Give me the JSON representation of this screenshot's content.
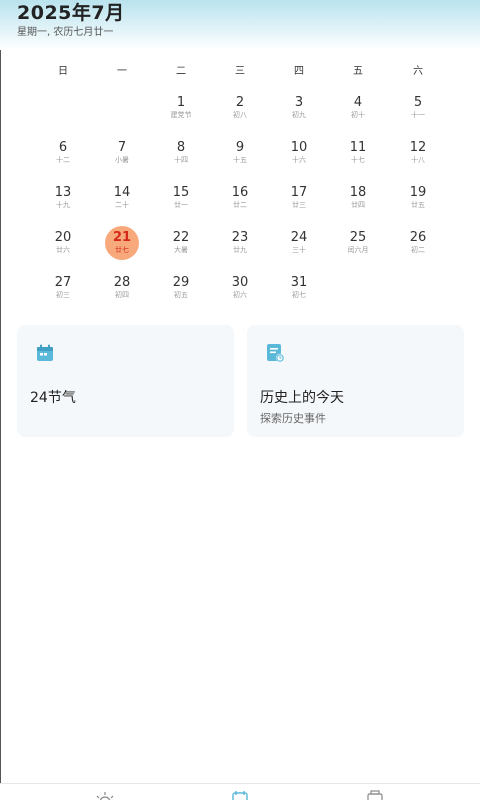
{
  "header": {
    "title": "2025年7月",
    "subtitle": "星期一, 农历七月廿一"
  },
  "weekdays": [
    "日",
    "一",
    "二",
    "三",
    "四",
    "五",
    "六"
  ],
  "calendar": {
    "first_weekday_index": 2,
    "today": 21,
    "days": [
      {
        "num": "1",
        "lunar": "建党节"
      },
      {
        "num": "2",
        "lunar": "初八"
      },
      {
        "num": "3",
        "lunar": "初九"
      },
      {
        "num": "4",
        "lunar": "初十"
      },
      {
        "num": "5",
        "lunar": "十一"
      },
      {
        "num": "6",
        "lunar": "十二"
      },
      {
        "num": "7",
        "lunar": "小暑"
      },
      {
        "num": "8",
        "lunar": "十四"
      },
      {
        "num": "9",
        "lunar": "十五"
      },
      {
        "num": "10",
        "lunar": "十六"
      },
      {
        "num": "11",
        "lunar": "十七"
      },
      {
        "num": "12",
        "lunar": "十八"
      },
      {
        "num": "13",
        "lunar": "十九"
      },
      {
        "num": "14",
        "lunar": "二十"
      },
      {
        "num": "15",
        "lunar": "廿一"
      },
      {
        "num": "16",
        "lunar": "廿二"
      },
      {
        "num": "17",
        "lunar": "廿三"
      },
      {
        "num": "18",
        "lunar": "廿四"
      },
      {
        "num": "19",
        "lunar": "廿五"
      },
      {
        "num": "20",
        "lunar": "廿六"
      },
      {
        "num": "21",
        "lunar": "廿七"
      },
      {
        "num": "22",
        "lunar": "大暑"
      },
      {
        "num": "23",
        "lunar": "廿九"
      },
      {
        "num": "24",
        "lunar": "三十"
      },
      {
        "num": "25",
        "lunar": "闰六月"
      },
      {
        "num": "26",
        "lunar": "初二"
      },
      {
        "num": "27",
        "lunar": "初三"
      },
      {
        "num": "28",
        "lunar": "初四"
      },
      {
        "num": "29",
        "lunar": "初五"
      },
      {
        "num": "30",
        "lunar": "初六"
      },
      {
        "num": "31",
        "lunar": "初七"
      }
    ]
  },
  "cards": {
    "solar_terms": {
      "title": "24节气",
      "icon": "calendar-icon"
    },
    "history": {
      "title": "历史上的今天",
      "subtitle": "探索历史事件",
      "icon": "history-document-icon"
    }
  },
  "colors": {
    "accent": "#5ab8d8",
    "today_bg": "#f8a97c",
    "today_text": "#d42a1a"
  },
  "nav": {
    "icons": [
      "weather-sun-icon",
      "calendar-icon",
      "tools-icon"
    ]
  }
}
